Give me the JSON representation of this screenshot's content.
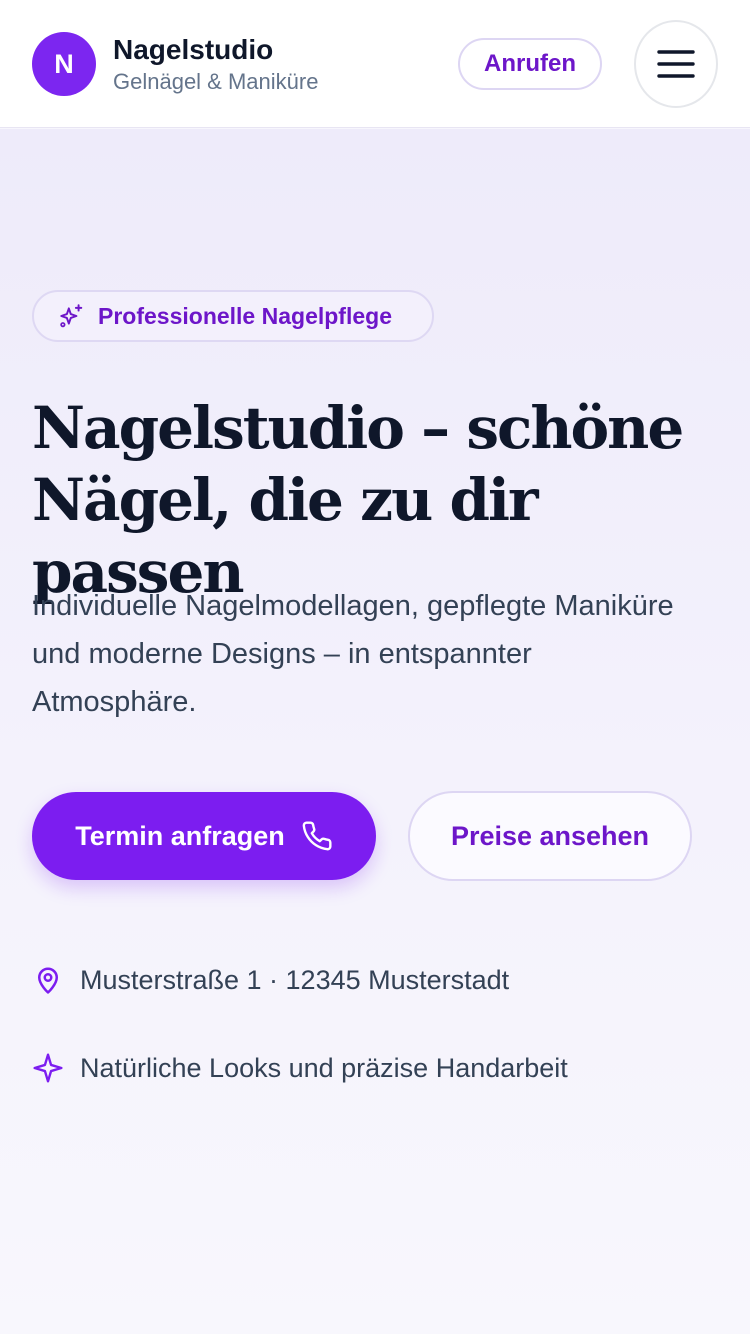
{
  "header": {
    "logo_letter": "N",
    "brand_name": "Nagelstudio",
    "brand_subtitle": "Gelnägel & Maniküre",
    "call_label": "Anrufen",
    "menu_icon": "hamburger-menu-icon"
  },
  "hero": {
    "badge_icon": "sparkles-icon",
    "badge_label": "Professionelle Nagelpflege",
    "title_line1": "Nagelstudio – schöne",
    "title_line2": "Nägel, die zu dir passen",
    "lead": "Individuelle Nagelmodellagen, gepflegte Maniküre und moderne Designs – in entspannter Atmosphäre.",
    "primary_button": "Termin anfragen",
    "primary_icon": "phone-icon",
    "secondary_button": "Preise ansehen",
    "info": [
      {
        "icon": "map-pin-icon",
        "text": "Musterstraße 1 · 12345 Musterstadt"
      },
      {
        "icon": "sparkle-icon",
        "text": "Natürliche Looks und präzise Handarbeit"
      }
    ]
  },
  "colors": {
    "accent": "#7c1df0",
    "accent_text": "#6d16c9",
    "heading": "#0f172a",
    "body_text": "#334155",
    "muted": "#64748b"
  }
}
